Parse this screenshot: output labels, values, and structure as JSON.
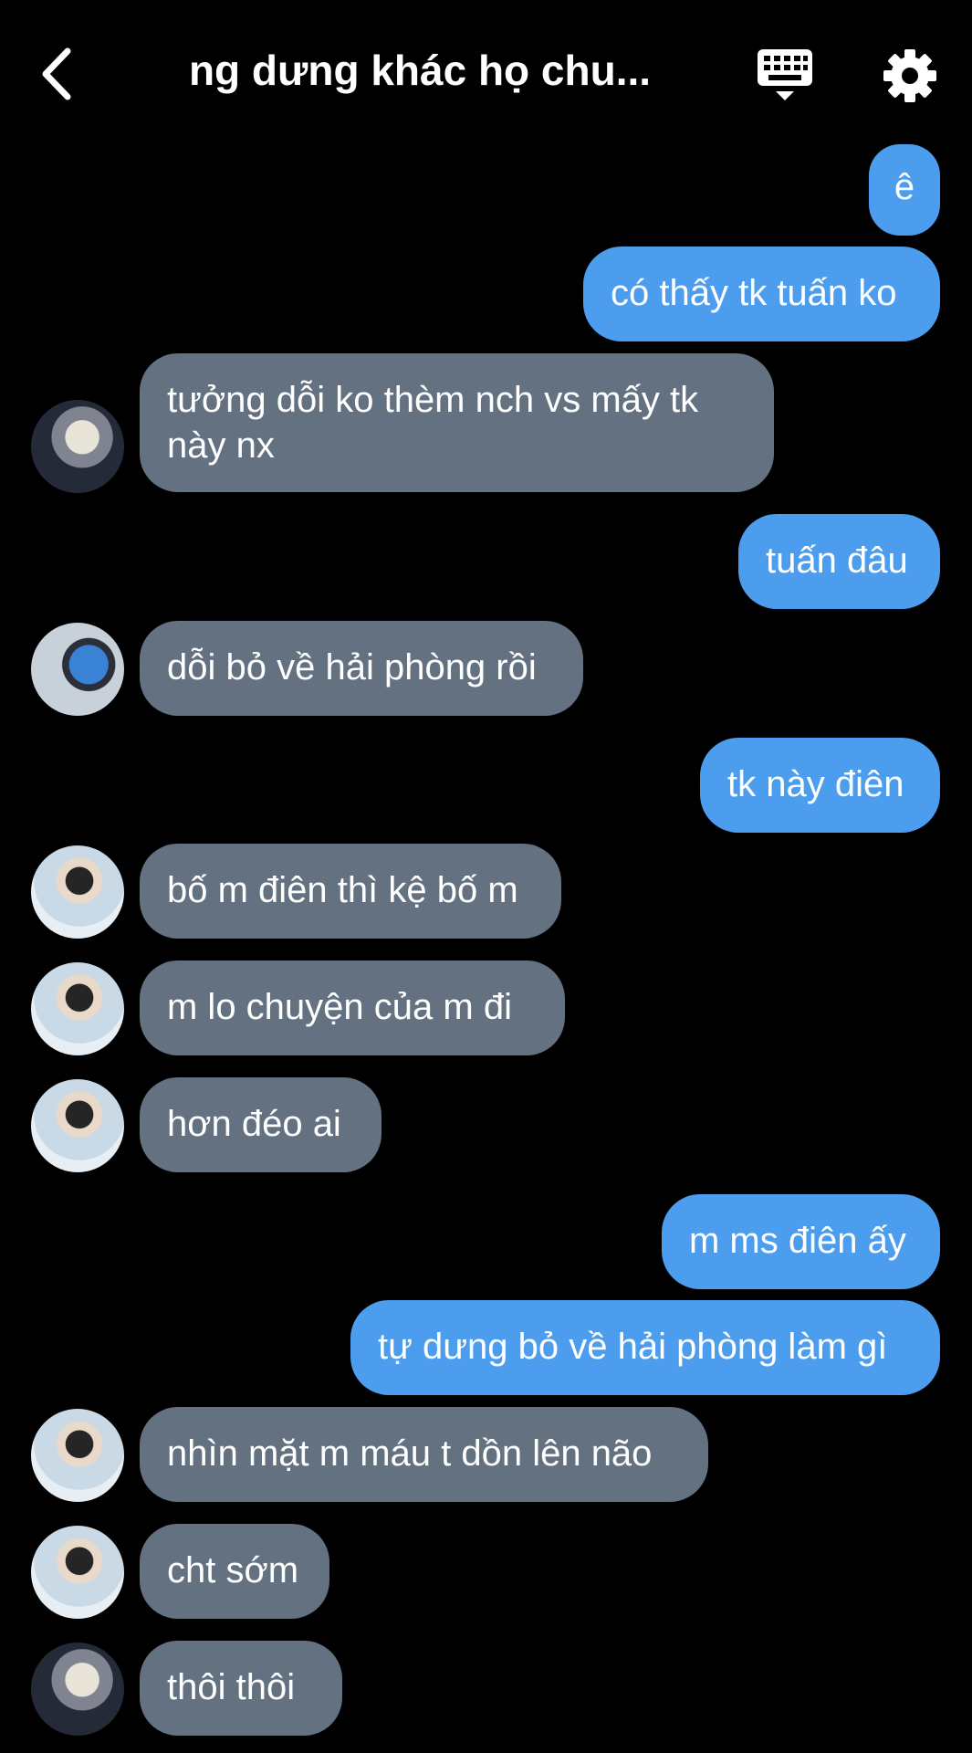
{
  "header": {
    "title": "ng dưng khác họ chu...",
    "back_icon": "chevron-left-icon",
    "keyboard_icon": "keyboard-icon",
    "settings_icon": "gear-icon"
  },
  "colors": {
    "background": "#000000",
    "outgoing_bubble": "#4c9ded",
    "incoming_bubble": "#637181",
    "text": "#ffffff"
  },
  "messages": [
    {
      "dir": "out",
      "text": "ê"
    },
    {
      "dir": "out",
      "text": "có thấy tk tuấn ko"
    },
    {
      "dir": "in",
      "avatar": "avatar-a",
      "text": "tưởng dỗi ko thèm nch vs mấy tk này nx"
    },
    {
      "dir": "out",
      "text": "tuấn đâu"
    },
    {
      "dir": "in",
      "avatar": "avatar-b",
      "text": "dỗi bỏ về hải phòng rồi"
    },
    {
      "dir": "out",
      "text": "tk này điên"
    },
    {
      "dir": "in",
      "avatar": "avatar-c",
      "text": "bố m điên thì kệ bố m"
    },
    {
      "dir": "in",
      "avatar": "avatar-c",
      "text": "m lo chuyện của m đi"
    },
    {
      "dir": "in",
      "avatar": "avatar-c",
      "text": "hơn đéo ai"
    },
    {
      "dir": "out",
      "text": "m ms điên ấy"
    },
    {
      "dir": "out",
      "text": "tự dưng bỏ về hải phòng làm gì"
    },
    {
      "dir": "in",
      "avatar": "avatar-c",
      "text": "nhìn mặt m máu t dồn lên não"
    },
    {
      "dir": "in",
      "avatar": "avatar-c",
      "text": "cht sớm"
    },
    {
      "dir": "in",
      "avatar": "avatar-a",
      "text": "thôi thôi"
    }
  ]
}
